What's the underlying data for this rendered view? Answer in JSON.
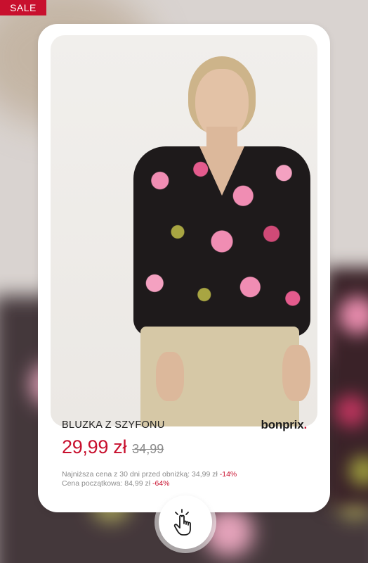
{
  "badge": {
    "label": "SALE"
  },
  "product": {
    "name": "BLUZKA Z SZYFONU",
    "brand": "bonprix",
    "brand_suffix": ".",
    "price_current": "29,99 zł",
    "price_old": "34,99",
    "lowest_price_text": "Najniższa cena z 30 dni  przed obniżką: 34,99 zł",
    "lowest_price_discount": "-14%",
    "original_price_text": "Cena początkowa: 84,99 zł",
    "original_price_discount": "-64%"
  },
  "icons": {
    "tap": "hand-tap-icon"
  },
  "colors": {
    "accent": "#c8102e",
    "text": "#222222",
    "muted": "#8c8c8c"
  }
}
